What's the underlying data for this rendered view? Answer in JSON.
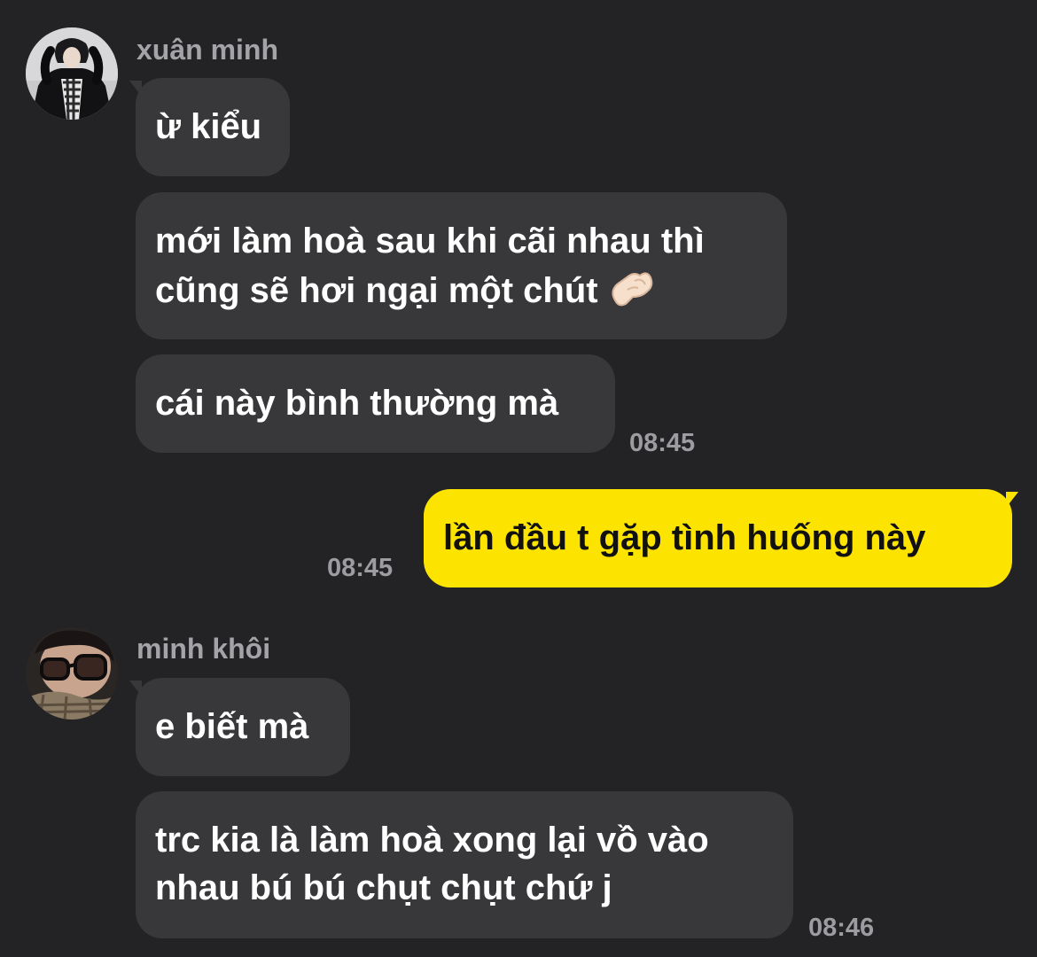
{
  "conversation": {
    "group1": {
      "sender": "xuân minh",
      "avatar_icon": "user-avatar-hoodie",
      "messages": [
        {
          "lines": [
            "ừ kiểu"
          ]
        },
        {
          "lines": [
            "mới làm hoà sau khi cãi nhau thì",
            "cũng sẽ hơi ngại một chút"
          ],
          "emoji": "pinching-hand-icon"
        },
        {
          "lines": [
            "cái này bình thường mà"
          ]
        }
      ],
      "time": "08:45"
    },
    "mine": {
      "lines": [
        "lần đầu t gặp tình huống này"
      ],
      "time": "08:45"
    },
    "group2": {
      "sender": "minh khôi",
      "avatar_icon": "user-avatar-glasses",
      "messages": [
        {
          "lines": [
            "e biết mà"
          ]
        },
        {
          "lines": [
            "trc kia là làm hoà xong lại vồ vào",
            "nhau bú bú chụt chụt chứ j"
          ]
        }
      ],
      "time": "08:46"
    }
  },
  "colors": {
    "background": "#232325",
    "incoming_bubble": "#38383b",
    "outgoing_bubble": "#fde400",
    "meta_text": "#a4a4a8"
  }
}
